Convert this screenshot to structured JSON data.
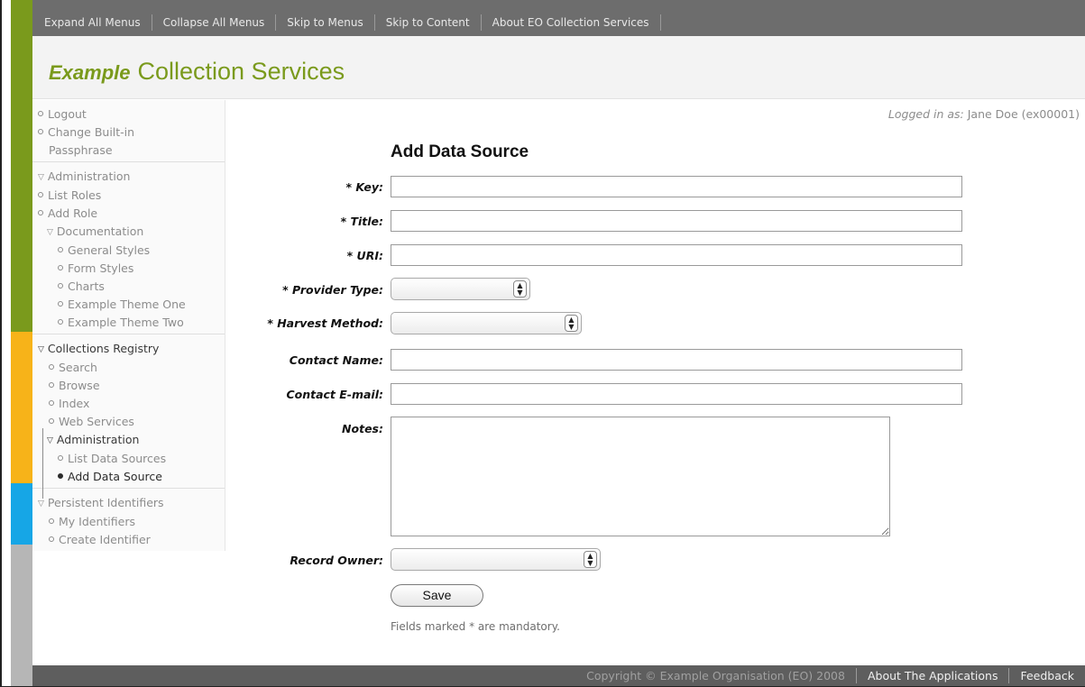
{
  "colors": {
    "brand_green": "#7a9a1c",
    "stripe_orange": "#f7b319",
    "stripe_blue": "#16a6e6",
    "nav_bg": "#6d6d6d"
  },
  "topnav": {
    "links": [
      "Expand All Menus",
      "Collapse All Menus",
      "Skip to Menus",
      "Skip to Content",
      "About EO Collection Services"
    ]
  },
  "header": {
    "brand_italic": "Example",
    "brand_title": "Collection Services"
  },
  "sidebar": {
    "account": [
      "Logout",
      "Change Built-in",
      "Passphrase"
    ],
    "administration": {
      "heading": "Administration",
      "items": [
        "List Roles",
        "Add Role"
      ],
      "documentation": {
        "heading": "Documentation",
        "items": [
          "General Styles",
          "Form Styles",
          "Charts",
          "Example Theme One",
          "Example Theme Two"
        ]
      }
    },
    "registry": {
      "heading": "Collections Registry",
      "items": [
        "Search",
        "Browse",
        "Index",
        "Web Services"
      ],
      "administration": {
        "heading": "Administration",
        "items": [
          "List Data Sources",
          "Add Data Source"
        ]
      }
    },
    "identifiers": {
      "heading": "Persistent Identifiers",
      "items": [
        "My Identifiers",
        "Create Identifier"
      ]
    }
  },
  "user": {
    "label": "Logged in as:",
    "name": "Jane Doe (ex00001)"
  },
  "form": {
    "title": "Add Data Source",
    "key_label": "* Key:",
    "key_value": "",
    "title_label": "* Title:",
    "title_value": "",
    "uri_label": "* URI:",
    "uri_value": "",
    "provider_type_label": "* Provider Type:",
    "provider_type_value": "",
    "harvest_method_label": "* Harvest Method:",
    "harvest_method_value": "",
    "contact_name_label": "Contact Name:",
    "contact_name_value": "",
    "contact_email_label": "Contact E-mail:",
    "contact_email_value": "",
    "notes_label": "Notes:",
    "notes_value": "",
    "record_owner_label": "Record Owner:",
    "record_owner_value": "",
    "save_label": "Save",
    "mandatory_note": "Fields marked * are mandatory."
  },
  "footer": {
    "copyright": "Copyright © Example Organisation (EO) 2008",
    "links": [
      "About The Applications",
      "Feedback"
    ]
  }
}
